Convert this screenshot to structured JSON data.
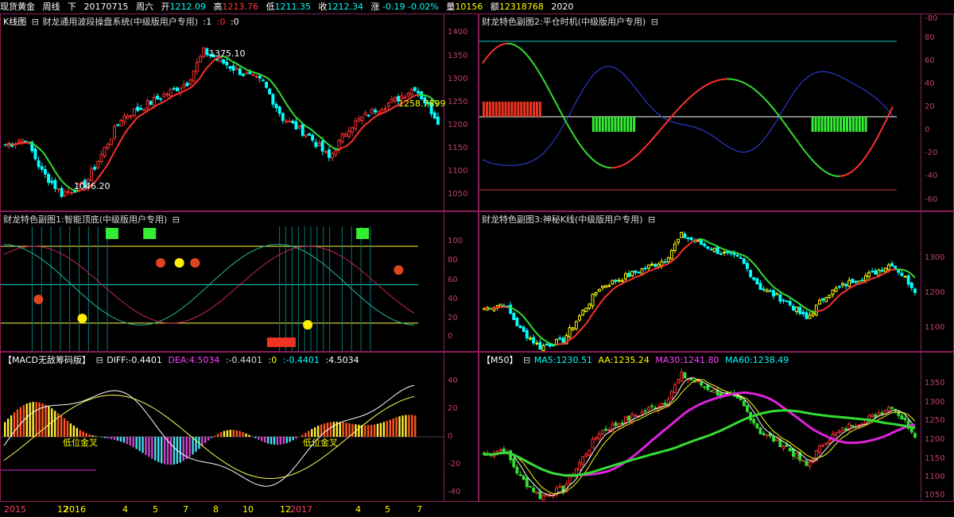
{
  "quote_bar": {
    "symbol": "现货黄金",
    "period": "周线",
    "nav": "下",
    "date": "20170715",
    "weekday": "周六",
    "open_label": "开",
    "open": "1212.09",
    "high_label": "高",
    "high": "1213.76",
    "low_label": "低",
    "low": "1211.35",
    "close_label": "收",
    "close": "1212.34",
    "change_label": "涨",
    "change": "-0.19",
    "change_pct": "-0.02%",
    "volume_label": "量",
    "volume": "10156",
    "amount_label": "额",
    "amount": "12318768",
    "extra": "2020"
  },
  "panels": {
    "kline": {
      "title": "K线图",
      "indicator": "财龙通用波段操盘系统(中级版用户专用)",
      "params": [
        ":1",
        ":0",
        ":0"
      ],
      "y_ticks": [
        "1400",
        "1350",
        "1300",
        "1250",
        "1200",
        "1150",
        "1100",
        "1050"
      ],
      "annotations": {
        "high": "1375.10",
        "low": "1046.20",
        "last": "1258.7899"
      }
    },
    "sub2": {
      "title": "财龙特色副图2:平仓时机(中级版用户专用)",
      "y_ticks": [
        "80",
        "60",
        "40",
        "20",
        "0",
        "-20",
        "-40",
        "-60",
        "-80"
      ]
    },
    "sub1": {
      "title": "财龙特色副图1:智能顶底(中级版用户专用)",
      "y_ticks": [
        "100",
        "80",
        "60",
        "40",
        "20",
        "0"
      ]
    },
    "sub3": {
      "title": "财龙特色副图3:神秘K线(中级版用户专用)",
      "y_ticks": [
        "1300",
        "1200",
        "1100"
      ]
    },
    "macd": {
      "title": "【MACD无敌筹码版】",
      "diff_label": "DIFF:",
      "diff": "-0.4401",
      "dea_label": "DEA:",
      "dea": "4.5034",
      "v1": ":-0.4401",
      "v2": ":0",
      "v3": ":-0.4401",
      "v4": ":4.5034",
      "y_ticks": [
        "40",
        "20",
        "0",
        "-20",
        "-40"
      ],
      "cross_labels": [
        "低位金叉",
        "低位金叉"
      ]
    },
    "m50": {
      "title": "【M50】",
      "ma5_label": "MA5:",
      "ma5": "1230.51",
      "aa_label": "AA:",
      "aa": "1235.24",
      "ma30_label": "MA30:",
      "ma30": "1241.80",
      "ma60_label": "MA60:",
      "ma60": "1238.49",
      "y_ticks": [
        "1350",
        "1300",
        "1250",
        "1200",
        "1150",
        "1100",
        "1050"
      ]
    }
  },
  "x_axis": [
    "2015",
    "12",
    "2016",
    "4",
    "5",
    "7",
    "8",
    "10",
    "12",
    "2017",
    "4",
    "5",
    "7"
  ],
  "colors": {
    "up": "#ff3030",
    "down": "#00ffff",
    "frame": "#8b1f5a",
    "axis_text": "#c0406a",
    "green": "#33dd33",
    "yellow": "#ffff00",
    "magenta": "#ff00ff"
  }
}
